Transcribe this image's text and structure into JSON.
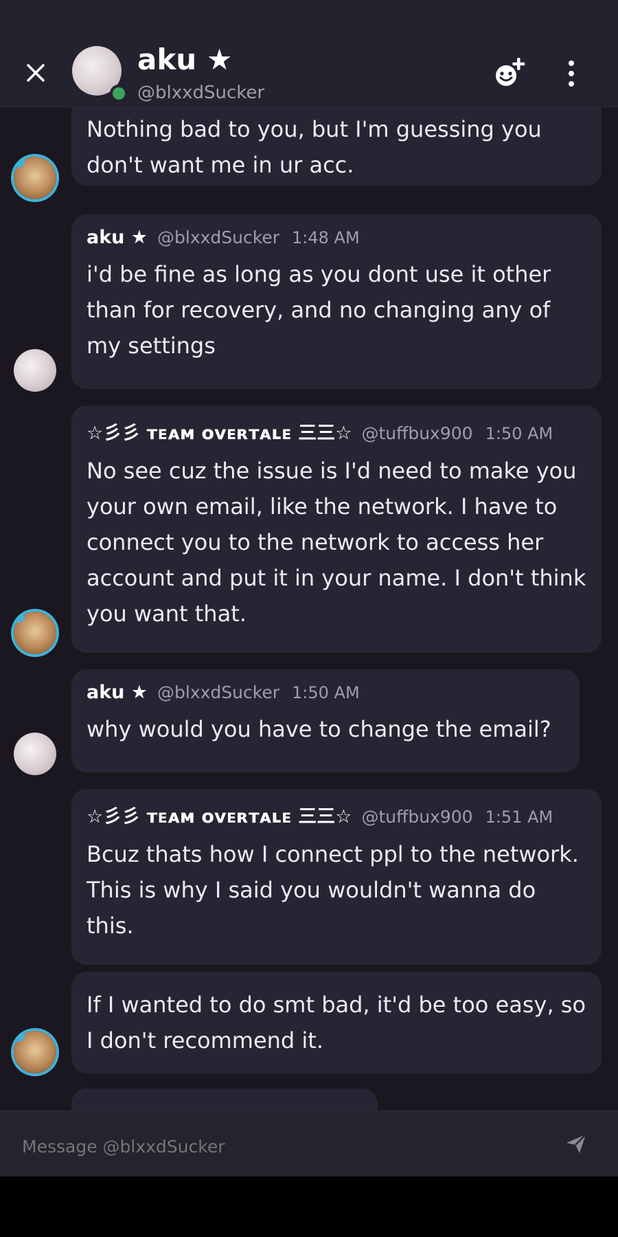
{
  "header": {
    "name": "aku ★",
    "handle": "@blxxdSucker"
  },
  "messages": [
    {
      "id": "m1",
      "text": "Nothing bad to you, but I'm guessing you don't want me in ur acc."
    },
    {
      "id": "m2",
      "author": "aku ★",
      "handle": "@blxxdSucker",
      "time": "1:48 AM",
      "text": "i'd be fine as long as you dont use it other than for recovery, and no changing any of my settings"
    },
    {
      "id": "m3",
      "author": "☆彡彡 ᴛᴇᴀᴍ ᴏᴠᴇʀᴛᴀʟᴇ 三三☆",
      "handle": "@tuffbux900",
      "time": "1:50 AM",
      "text": "No see cuz the issue is I'd need to make you your own email, like the network. I have to connect you to the network to access her account and put it in your name. I don't think you want that."
    },
    {
      "id": "m4",
      "author": "aku ★",
      "handle": "@blxxdSucker",
      "time": "1:50 AM",
      "text": "why would you have to change the email?"
    },
    {
      "id": "m5",
      "author": "☆彡彡 ᴛᴇᴀᴍ ᴏᴠᴇʀᴛᴀʟᴇ 三三☆",
      "handle": "@tuffbux900",
      "time": "1:51 AM",
      "text": "Bcuz thats how I connect ppl to the network. This is why I said you wouldn't wanna do this."
    },
    {
      "id": "m6",
      "text": "If I wanted to do smt bad, it'd be too easy, so I don't recommend it."
    }
  ],
  "composer": {
    "placeholder": "Message @blxxdSucker"
  },
  "icons": {
    "close": "close-icon",
    "add_friend": "add-friend-icon",
    "more": "more-vertical-icon",
    "send": "send-icon"
  },
  "colors": {
    "background": "#1a1720",
    "header": "#23222e",
    "bubble": "#272533",
    "online": "#3ba55c"
  }
}
